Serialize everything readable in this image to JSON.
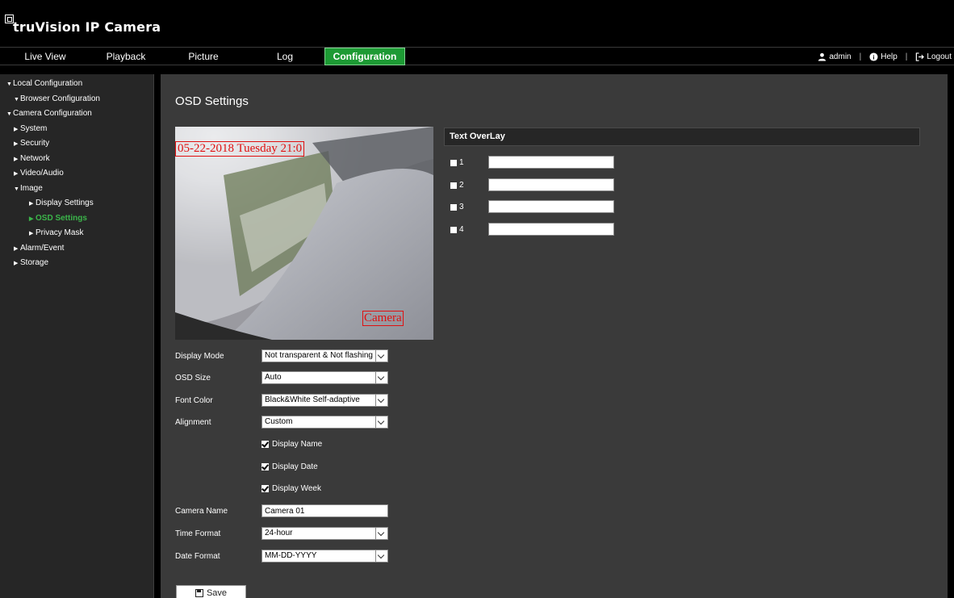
{
  "header": {
    "app_title": "truVision  IP Camera"
  },
  "nav": {
    "tabs": [
      {
        "label": "Live View"
      },
      {
        "label": "Playback"
      },
      {
        "label": "Picture"
      },
      {
        "label": "Log"
      },
      {
        "label": "Configuration",
        "active": true
      }
    ],
    "user": {
      "name": "admin",
      "help": "Help",
      "logout": "Logout"
    }
  },
  "sidebar": {
    "items": [
      {
        "label": "Local Configuration"
      },
      {
        "label": "Browser Configuration"
      },
      {
        "label": "Camera Configuration"
      },
      {
        "label": "System"
      },
      {
        "label": "Security"
      },
      {
        "label": "Network"
      },
      {
        "label": "Video/Audio"
      },
      {
        "label": "Image"
      },
      {
        "label": "Display Settings"
      },
      {
        "label": "OSD Settings",
        "active": true
      },
      {
        "label": "Privacy Mask"
      },
      {
        "label": "Alarm/Event"
      },
      {
        "label": "Storage"
      }
    ]
  },
  "main": {
    "title": "OSD Settings",
    "preview": {
      "date_overlay": "05-22-2018 Tuesday 21:0",
      "name_overlay": "Camera"
    },
    "form": {
      "display_mode": {
        "label": "Display Mode",
        "value": "Not transparent & Not flashing"
      },
      "osd_size": {
        "label": "OSD Size",
        "value": "Auto"
      },
      "font_color": {
        "label": "Font Color",
        "value": "Black&White Self-adaptive"
      },
      "alignment": {
        "label": "Alignment",
        "value": "Custom"
      },
      "display_name": {
        "label": "Display Name",
        "checked": true
      },
      "display_date": {
        "label": "Display Date",
        "checked": true
      },
      "display_week": {
        "label": "Display Week",
        "checked": true
      },
      "camera_name": {
        "label": "Camera Name",
        "value": "Camera 01"
      },
      "time_format": {
        "label": "Time Format",
        "value": "24-hour"
      },
      "date_format": {
        "label": "Date Format",
        "value": "MM-DD-YYYY"
      },
      "save_label": "Save"
    },
    "text_overlay": {
      "title": "Text OverLay",
      "rows": [
        {
          "label": "1",
          "value": ""
        },
        {
          "label": "2",
          "value": ""
        },
        {
          "label": "3",
          "value": ""
        },
        {
          "label": "4",
          "value": ""
        }
      ]
    }
  },
  "colors": {
    "accent_green": "#1d9a34",
    "active_tree": "#3bb54a",
    "overlay_red": "#e01010",
    "panel_bg": "#3a3a3a",
    "sidebar_bg": "#262626"
  }
}
